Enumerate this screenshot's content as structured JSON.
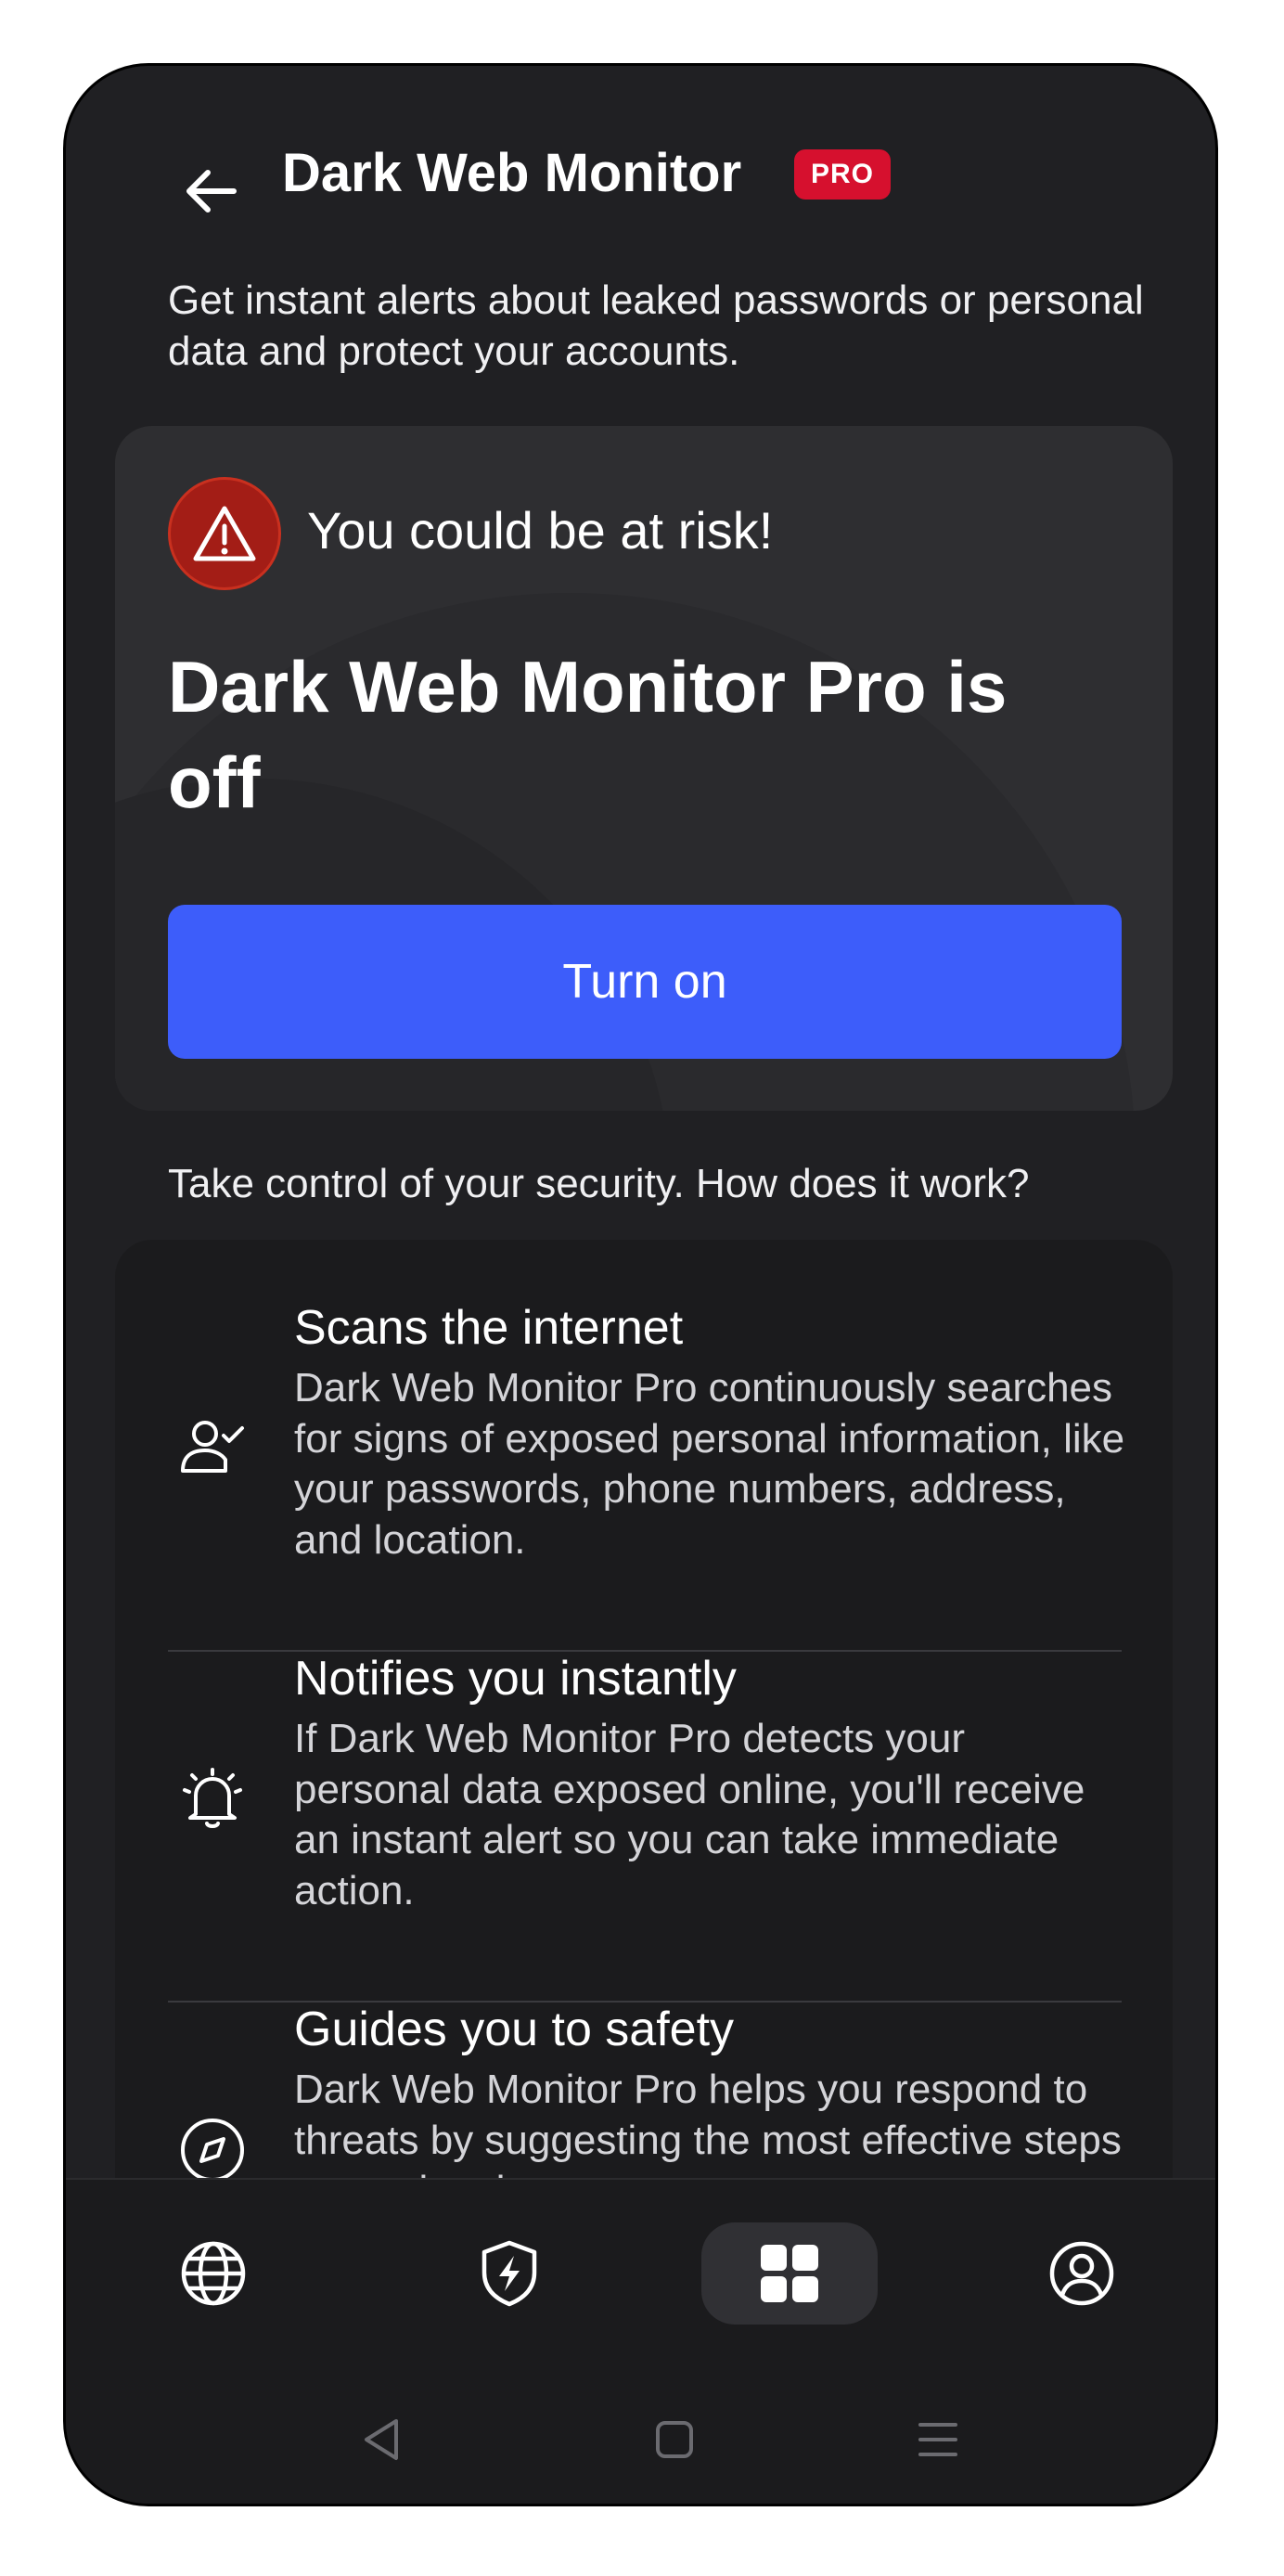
{
  "header": {
    "title": "Dark Web Monitor",
    "badge": "PRO",
    "back_icon": "arrow-left-icon"
  },
  "subtitle": "Get instant alerts about leaked passwords or personal data and protect your accounts.",
  "risk_card": {
    "warning_icon": "warning-triangle-icon",
    "risk_text": "You could be at risk!",
    "status_title": "Dark Web Monitor Pro is off",
    "button_label": "Turn on"
  },
  "how_it_works": "Take control of your security. How does it work?",
  "features": [
    {
      "icon": "user-check-icon",
      "title": "Scans the internet",
      "description": "Dark Web Monitor Pro continuously searches for signs of exposed personal information, like your passwords, phone numbers, address, and location."
    },
    {
      "icon": "bell-ringing-icon",
      "title": "Notifies you instantly",
      "description": "If Dark Web Monitor Pro detects your personal data exposed online, you'll receive an instant alert so you can take immediate action."
    },
    {
      "icon": "compass-icon",
      "title": "Guides you to safety",
      "description": "Dark Web Monitor Pro helps you respond to threats by suggesting the most effective steps to resolve data exposures."
    }
  ],
  "bottom_nav": [
    {
      "icon": "globe-icon",
      "active": false
    },
    {
      "icon": "shield-bolt-icon",
      "active": false
    },
    {
      "icon": "grid-icon",
      "active": true
    },
    {
      "icon": "profile-icon",
      "active": false
    }
  ],
  "system_nav": [
    "back-triangle-icon",
    "home-square-icon",
    "recents-menu-icon"
  ],
  "colors": {
    "background": "#202023",
    "card": "#2e2e31",
    "accent": "#3d5dfa",
    "badge": "#d6102e",
    "warning": "#a31d16"
  }
}
